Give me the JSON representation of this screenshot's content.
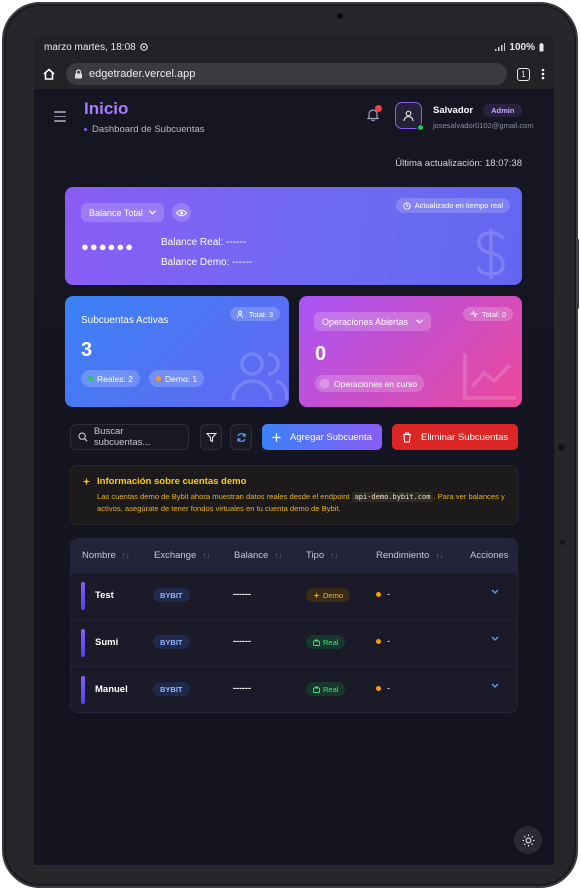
{
  "status": {
    "time": "marzo martes, 18:08",
    "battery": "100%"
  },
  "browser": {
    "url": "edgetrader.vercel.app",
    "tabs": "1"
  },
  "header": {
    "title": "Inicio",
    "subtitle": "Dashboard de Subcuentas",
    "user_name": "Salvador",
    "user_role": "Admin",
    "user_email": "josesalvador0102@gmail.com"
  },
  "last_update": "Última actualización: 18:07:38",
  "balance": {
    "selector": "Balance Total",
    "realtime": "Actualizado en tiempo real",
    "masked_total": "●●●●●●",
    "real_label": "Balance Real: ------",
    "demo_label": "Balance Demo: ------"
  },
  "subaccounts": {
    "title": "Subcuentas Activas",
    "total": "Total: 3",
    "count": "3",
    "reales": "Reales: 2",
    "demo": "Demo: 1"
  },
  "operations": {
    "selector": "Operaciones Abiertas",
    "total": "Total: 0",
    "count": "0",
    "status": "Operaciones en curso"
  },
  "toolbar": {
    "search_placeholder": "Buscar subcuentas...",
    "add_label": "Agregar Subcuenta",
    "delete_label": "Eliminar Subcuentas"
  },
  "info": {
    "title": "Información sobre cuentas demo",
    "text_before": "Las cuentas demo de Bybit ahora muestran datos reales desde el endpoint",
    "code": "api-demo.bybit.com",
    "text_after": ". Para ver balances y activos, asegúrate de tener fondos virtuales en tu cuenta demo de Bybit."
  },
  "table": {
    "headers": [
      "Nombre",
      "Exchange",
      "Balance",
      "Tipo",
      "Rendimiento",
      "Acciones"
    ],
    "rows": [
      {
        "name": "Test",
        "exchange": "BYBIT",
        "balance": "------",
        "type": "Demo",
        "performance": "-"
      },
      {
        "name": "Sumi",
        "exchange": "BYBIT",
        "balance": "------",
        "type": "Real",
        "performance": "-"
      },
      {
        "name": "Manuel",
        "exchange": "BYBIT",
        "balance": "------",
        "type": "Real",
        "performance": "-"
      }
    ]
  },
  "colors": {
    "accent": "#8b5cf6",
    "danger": "#dc2626",
    "success": "#22c55e",
    "warning": "#f59e0b"
  }
}
